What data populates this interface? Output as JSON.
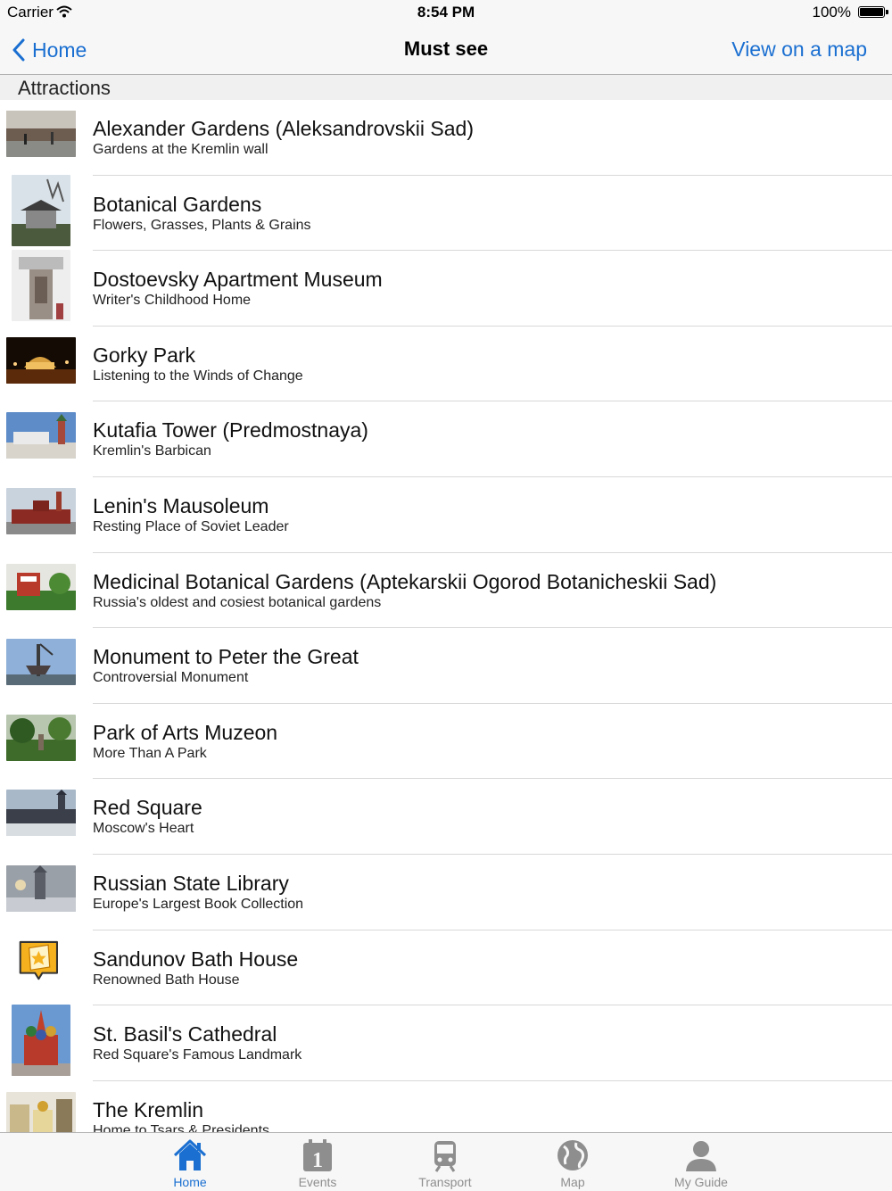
{
  "status_bar": {
    "carrier": "Carrier",
    "time": "8:54 PM",
    "battery": "100%"
  },
  "nav": {
    "back_label": "Home",
    "title": "Must see",
    "right_label": "View on a map"
  },
  "section": {
    "header": "Attractions"
  },
  "items": [
    {
      "title": "Alexander Gardens (Aleksandrovskii Sad)",
      "subtitle": "Gardens at the Kremlin wall"
    },
    {
      "title": "Botanical Gardens",
      "subtitle": "Flowers, Grasses, Plants & Grains"
    },
    {
      "title": "Dostoevsky Apartment Museum",
      "subtitle": "Writer's Childhood Home"
    },
    {
      "title": "Gorky Park",
      "subtitle": "Listening to the Winds of Change"
    },
    {
      "title": "Kutafia Tower  (Predmostnaya)",
      "subtitle": "Kremlin's Barbican"
    },
    {
      "title": "Lenin's Mausoleum",
      "subtitle": "Resting Place of Soviet Leader"
    },
    {
      "title": "Medicinal Botanical Gardens (Aptekarskii Ogorod Botanicheskii Sad)",
      "subtitle": "Russia's oldest and cosiest botanical gardens"
    },
    {
      "title": "Monument to Peter the Great",
      "subtitle": "Controversial Monument"
    },
    {
      "title": "Park of Arts Muzeon",
      "subtitle": "More Than A Park"
    },
    {
      "title": "Red Square",
      "subtitle": "Moscow's Heart"
    },
    {
      "title": "Russian State Library",
      "subtitle": "Europe's Largest Book Collection"
    },
    {
      "title": "Sandunov Bath House",
      "subtitle": "Renowned Bath House"
    },
    {
      "title": "St. Basil's Cathedral",
      "subtitle": "Red Square's Famous Landmark"
    },
    {
      "title": "The Kremlin",
      "subtitle": "Home to Tsars & Presidents"
    }
  ],
  "tabs": [
    {
      "label": "Home",
      "icon": "home-icon",
      "active": true
    },
    {
      "label": "Events",
      "icon": "calendar-icon",
      "active": false
    },
    {
      "label": "Transport",
      "icon": "train-icon",
      "active": false
    },
    {
      "label": "Map",
      "icon": "globe-icon",
      "active": false
    },
    {
      "label": "My Guide",
      "icon": "person-icon",
      "active": false
    }
  ],
  "colors": {
    "accent": "#1a6fd1",
    "tab_inactive": "#8e8e8e",
    "bar_background": "#f7f7f7"
  }
}
